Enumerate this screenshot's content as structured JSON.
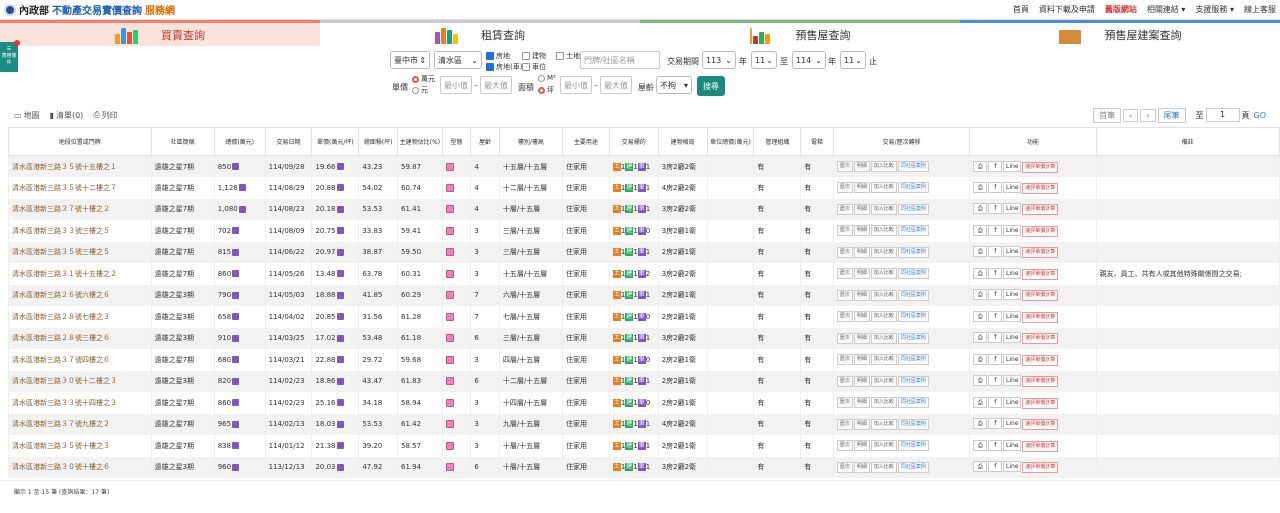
{
  "header": {
    "moi": "內政部",
    "title_blue": "不動產交易實價查詢",
    "title_orange": "服務網",
    "nav": [
      "首頁",
      "資料下載及申請",
      "舊版網站",
      "相關連結 ▾",
      "支援服務 ▾",
      "線上客服"
    ]
  },
  "side": {
    "label": "適用條件"
  },
  "tabs": [
    "買賣查詢",
    "租賃查詢",
    "預售屋查詢",
    "預售屋建案查詢"
  ],
  "filters": {
    "city": "臺中市",
    "district": "清水區",
    "types": [
      {
        "label": "房地",
        "checked": true
      },
      {
        "label": "建物",
        "checked": false
      },
      {
        "label": "土地",
        "checked": false
      },
      {
        "label": "房地(車)",
        "checked": true
      },
      {
        "label": "車位",
        "checked": false
      }
    ],
    "keyword_placeholder": "門牌/社區名稱",
    "period_label": "交易期間",
    "from_year": "113",
    "year_unit1": "年",
    "from_month": "11",
    "to_label": "至",
    "to_year": "114",
    "year_unit2": "年",
    "to_month": "11",
    "end_label": "止",
    "price_label": "單價",
    "price_units": [
      {
        "label": "萬元",
        "on": true
      },
      {
        "label": "元",
        "on": false
      }
    ],
    "min_placeholder": "最小值",
    "max_placeholder": "最大值",
    "dash": "-",
    "area_label": "面積",
    "area_units": [
      {
        "label": "M²",
        "on": false
      },
      {
        "label": "坪",
        "on": true
      }
    ],
    "area_min": "最小值",
    "area_max": "最大值",
    "age_label": "屋齡",
    "age_value": "不拘",
    "search": "搜尋"
  },
  "toolbar": {
    "map": "地圖",
    "list": "清單(0)",
    "print": "列印",
    "pager": {
      "first": "首筆",
      "prev": "‹",
      "next": "›",
      "last": "尾筆",
      "to": "至",
      "page": "1",
      "page_unit": "頁",
      "go": "GO"
    }
  },
  "columns": [
    "地段位置或門牌",
    "社區簡稱",
    "總價(萬元)",
    "交易日期",
    "單價(萬元/坪)",
    "總面積(坪)",
    "主建物佔比(%)",
    "型態",
    "屋齡",
    "樓別/樓高",
    "主要用途",
    "交易標的",
    "建物格局",
    "車位總價(萬元)",
    "管理組織",
    "電梯",
    "交易/歷次轉移",
    "功能",
    "備註"
  ],
  "actions": {
    "hist": "歷次",
    "detail": "明細",
    "compare": "加入比較",
    "same": "同社區案例",
    "print_icon": "⎙",
    "fb": "f",
    "line": "Line",
    "calc": "速評單價計算"
  },
  "rows": [
    {
      "addr": "清水區港新三路３５號十五樓之１",
      "comm": "遠雄之星7期",
      "price": "850",
      "date": "114/09/28",
      "unit": "19.66",
      "area": "43.23",
      "ratio": "59.87",
      "age": "4",
      "floor": "十五層/十五層",
      "use": "住家用",
      "tgt": [
        "1",
        "1",
        "1"
      ],
      "layout": "3房2廳2衛",
      "park": "",
      "mgmt": "有",
      "lift": "有",
      "note": ""
    },
    {
      "addr": "清水區港新三路３５號十二樓之７",
      "comm": "遠雄之星7期",
      "price": "1,128",
      "date": "114/08/29",
      "unit": "20.88",
      "area": "54.02",
      "ratio": "60.74",
      "age": "4",
      "floor": "十二層/十五層",
      "use": "住家用",
      "tgt": [
        "1",
        "1",
        "1"
      ],
      "layout": "4房2廳2衛",
      "park": "",
      "mgmt": "有",
      "lift": "有",
      "note": ""
    },
    {
      "addr": "清水區港新三路３７號十樓之２",
      "comm": "遠雄之星7期",
      "price": "1,080",
      "date": "114/08/23",
      "unit": "20.18",
      "area": "53.53",
      "ratio": "61.41",
      "age": "4",
      "floor": "十層/十五層",
      "use": "住家用",
      "tgt": [
        "1",
        "1",
        "1"
      ],
      "layout": "3房2廳2衛",
      "park": "",
      "mgmt": "有",
      "lift": "有",
      "note": ""
    },
    {
      "addr": "清水區港新三路３３號三樓之５",
      "comm": "遠雄之星7期",
      "price": "702",
      "date": "114/08/09",
      "unit": "20.75",
      "area": "33.83",
      "ratio": "59.41",
      "age": "3",
      "floor": "三層/十五層",
      "use": "住家用",
      "tgt": [
        "1",
        "1",
        "0"
      ],
      "layout": "3房2廳1衛",
      "park": "",
      "mgmt": "有",
      "lift": "有",
      "note": ""
    },
    {
      "addr": "清水區港新三路３５號三樓之５",
      "comm": "遠雄之星7期",
      "price": "815",
      "date": "114/06/22",
      "unit": "20.97",
      "area": "38.87",
      "ratio": "59.50",
      "age": "3",
      "floor": "三層/十五層",
      "use": "住家用",
      "tgt": [
        "1",
        "1",
        "1"
      ],
      "layout": "2房2廳1衛",
      "park": "",
      "mgmt": "有",
      "lift": "有",
      "note": ""
    },
    {
      "addr": "清水區港新三路３１號十五樓之２",
      "comm": "遠雄之星7期",
      "price": "860",
      "date": "114/05/26",
      "unit": "13.48",
      "area": "63.78",
      "ratio": "60.31",
      "age": "3",
      "floor": "十五層/十五層",
      "use": "住家用",
      "tgt": [
        "1",
        "1",
        "2"
      ],
      "layout": "3房2廳2衛",
      "park": "",
      "mgmt": "有",
      "lift": "有",
      "note": "親友、員工、共有人或其他特殊關係間之交易;"
    },
    {
      "addr": "清水區港新三路２６號六樓之６",
      "comm": "遠雄之星3期",
      "price": "790",
      "date": "114/05/03",
      "unit": "18.88",
      "area": "41.85",
      "ratio": "60.29",
      "age": "7",
      "floor": "六層/十五層",
      "use": "住家用",
      "tgt": [
        "1",
        "1",
        "1"
      ],
      "layout": "2房2廳1衛",
      "park": "",
      "mgmt": "有",
      "lift": "有",
      "note": ""
    },
    {
      "addr": "清水區港新三路２８號七樓之３",
      "comm": "遠雄之星3期",
      "price": "658",
      "date": "114/04/02",
      "unit": "20.85",
      "area": "31.56",
      "ratio": "61.28",
      "age": "7",
      "floor": "七層/十五層",
      "use": "住家用",
      "tgt": [
        "1",
        "1",
        "0"
      ],
      "layout": "2房2廳1衛",
      "park": "",
      "mgmt": "有",
      "lift": "有",
      "note": ""
    },
    {
      "addr": "清水區港新三路２８號三樓之６",
      "comm": "遠雄之星3期",
      "price": "910",
      "date": "114/03/25",
      "unit": "17.02",
      "area": "53.48",
      "ratio": "61.18",
      "age": "6",
      "floor": "三層/十五層",
      "use": "住家用",
      "tgt": [
        "1",
        "1",
        "1"
      ],
      "layout": "3房2廳2衛",
      "park": "",
      "mgmt": "有",
      "lift": "有",
      "note": ""
    },
    {
      "addr": "清水區港新三路３７號四樓之６",
      "comm": "遠雄之星7期",
      "price": "680",
      "date": "114/03/21",
      "unit": "22.88",
      "area": "29.72",
      "ratio": "59.68",
      "age": "3",
      "floor": "四層/十五層",
      "use": "住家用",
      "tgt": [
        "1",
        "1",
        "0"
      ],
      "layout": "2房2廳1衛",
      "park": "",
      "mgmt": "有",
      "lift": "有",
      "note": ""
    },
    {
      "addr": "清水區港新三路３０號十二樓之３",
      "comm": "遠雄之星3期",
      "price": "820",
      "date": "114/02/23",
      "unit": "18.86",
      "area": "43.47",
      "ratio": "61.83",
      "age": "6",
      "floor": "十二層/十五層",
      "use": "住家用",
      "tgt": [
        "1",
        "1",
        "1"
      ],
      "layout": "2房2廳1衛",
      "park": "",
      "mgmt": "有",
      "lift": "有",
      "note": ""
    },
    {
      "addr": "清水區港新三路３３號十四樓之３",
      "comm": "遠雄之星7期",
      "price": "860",
      "date": "114/02/23",
      "unit": "25.16",
      "area": "34.18",
      "ratio": "58.94",
      "age": "3",
      "floor": "十四層/十五層",
      "use": "住家用",
      "tgt": [
        "1",
        "1",
        "0"
      ],
      "layout": "2房2廳1衛",
      "park": "",
      "mgmt": "有",
      "lift": "有",
      "note": ""
    },
    {
      "addr": "清水區港新三路３７號九樓之２",
      "comm": "遠雄之星7期",
      "price": "965",
      "date": "114/02/13",
      "unit": "18.03",
      "area": "53.53",
      "ratio": "61.42",
      "age": "3",
      "floor": "九層/十五層",
      "use": "住家用",
      "tgt": [
        "1",
        "1",
        "1"
      ],
      "layout": "4房2廳2衛",
      "park": "",
      "mgmt": "有",
      "lift": "有",
      "note": ""
    },
    {
      "addr": "清水區港新三路３５號十樓之３",
      "comm": "遠雄之星7期",
      "price": "838",
      "date": "114/01/12",
      "unit": "21.38",
      "area": "39.20",
      "ratio": "58.57",
      "age": "3",
      "floor": "十層/十五層",
      "use": "住家用",
      "tgt": [
        "1",
        "1",
        "1"
      ],
      "layout": "2房2廳1衛",
      "park": "",
      "mgmt": "有",
      "lift": "有",
      "note": ""
    },
    {
      "addr": "清水區港新三路３０號十樓之６",
      "comm": "遠雄之星3期",
      "price": "960",
      "date": "113/12/13",
      "unit": "20.03",
      "area": "47.92",
      "ratio": "61.94",
      "age": "6",
      "floor": "十層/十五層",
      "use": "住家用",
      "tgt": [
        "1",
        "1",
        "1"
      ],
      "layout": "3房2廳2衛",
      "park": "",
      "mgmt": "有",
      "lift": "有",
      "note": ""
    }
  ],
  "tgt_labels": [
    "土",
    "建",
    "車"
  ],
  "footer": "顯示 1 至 15 筆 (查詢結果：17 筆)"
}
